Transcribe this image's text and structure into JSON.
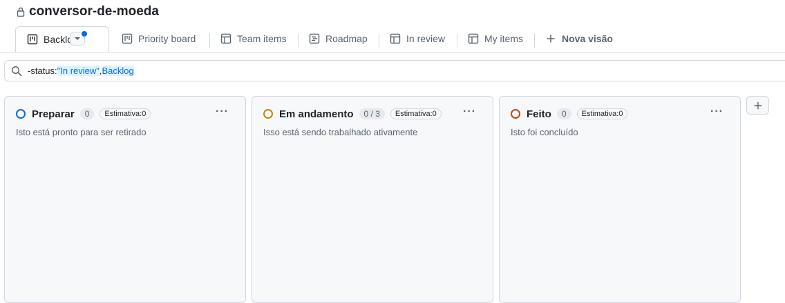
{
  "repo": {
    "name": "conversor-de-moeda",
    "lock_icon": "lock-icon"
  },
  "tabs": [
    {
      "label": "Backlog",
      "icon": "board-icon",
      "active": true
    },
    {
      "label": "Priority board",
      "icon": "board-icon"
    },
    {
      "label": "Team items",
      "icon": "table-icon"
    },
    {
      "label": "Roadmap",
      "icon": "roadmap-icon"
    },
    {
      "label": "In review",
      "icon": "table-icon"
    },
    {
      "label": "My items",
      "icon": "table-icon"
    },
    {
      "label": "Nova visão",
      "icon": "plus-icon"
    }
  ],
  "filter": {
    "prefix": "-status:",
    "value1": "\"In review\"",
    "comma": ",",
    "value2": "Backlog"
  },
  "columns": [
    {
      "name": "Preparar",
      "count": "0",
      "estimate": "Estimativa:0",
      "description": "Isto está pronto para ser retirado",
      "color": "#0969da"
    },
    {
      "name": "Em andamento",
      "count": "0 / 3",
      "estimate": "Estimativa:0",
      "description": "Isso está sendo trabalhado ativamente",
      "color": "#bf8700"
    },
    {
      "name": "Feito",
      "count": "0",
      "estimate": "Estimativa:0",
      "description": "Isto foi concluído",
      "color": "#bc4c00"
    }
  ],
  "menu_glyph": "···",
  "add_column_glyph": "+"
}
